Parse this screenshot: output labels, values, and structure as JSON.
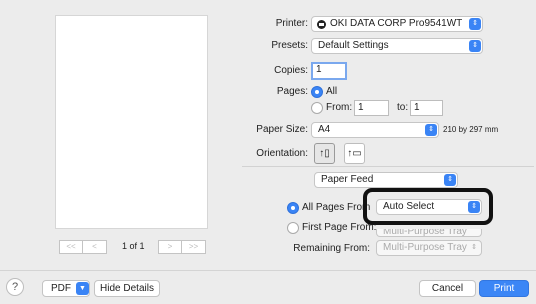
{
  "preview": {
    "nav_first": "<<",
    "nav_prev": "<",
    "page_indicator": "1 of 1",
    "nav_next": ">",
    "nav_last": ">>"
  },
  "printer": {
    "label": "Printer:",
    "value": "OKI DATA CORP Pro9541WT",
    "icon": "printer-status-icon"
  },
  "presets": {
    "label": "Presets:",
    "value": "Default Settings"
  },
  "copies": {
    "label": "Copies:",
    "value": "1"
  },
  "pages": {
    "label": "Pages:",
    "all_label": "All",
    "from_label": "From:",
    "from_value": "1",
    "to_label": "to:",
    "to_value": "1",
    "selected": "All"
  },
  "paper_size": {
    "label": "Paper Size:",
    "value": "A4",
    "dimensions": "210 by 297 mm"
  },
  "orientation": {
    "label": "Orientation:",
    "selected": "portrait"
  },
  "section": {
    "value": "Paper Feed"
  },
  "paper_feed": {
    "all_pages_from_label": "All Pages From",
    "all_pages_from_value": "Auto Select",
    "first_page_from_label": "First Page From:",
    "first_page_from_value": "Multi-Purpose Tray",
    "remaining_from_label": "Remaining From:",
    "remaining_from_value": "Multi-Purpose Tray",
    "selected": "All Pages From"
  },
  "footer": {
    "help": "?",
    "pdf": "PDF",
    "hide_details": "Hide Details",
    "cancel": "Cancel",
    "print": "Print"
  },
  "colors": {
    "accent": "#3b86f6",
    "highlight": "#111111"
  }
}
